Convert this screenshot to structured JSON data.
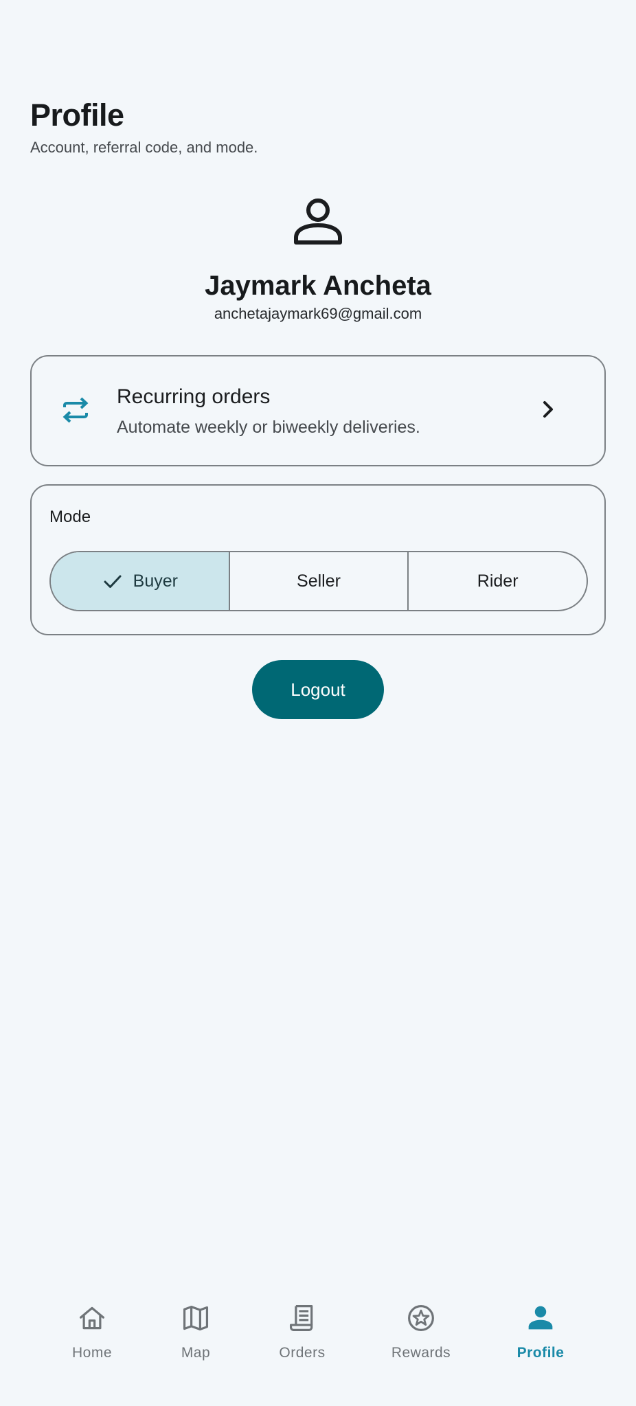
{
  "header": {
    "title": "Profile",
    "subtitle": "Account, referral code, and mode."
  },
  "user": {
    "avatar_icon": "person-icon",
    "name": "Jaymark Ancheta",
    "email": "anchetajaymark69@gmail.com"
  },
  "recurring": {
    "icon": "repeat-icon",
    "title": "Recurring orders",
    "description": "Automate weekly or biweekly deliveries."
  },
  "mode": {
    "label": "Mode",
    "options": [
      {
        "label": "Buyer",
        "selected": true
      },
      {
        "label": "Seller",
        "selected": false
      },
      {
        "label": "Rider",
        "selected": false
      }
    ]
  },
  "logout_label": "Logout",
  "nav": {
    "items": [
      {
        "label": "Home",
        "icon": "home-icon",
        "active": false
      },
      {
        "label": "Map",
        "icon": "map-icon",
        "active": false
      },
      {
        "label": "Orders",
        "icon": "receipt-icon",
        "active": false
      },
      {
        "label": "Rewards",
        "icon": "star-badge-icon",
        "active": false
      },
      {
        "label": "Profile",
        "icon": "person-icon",
        "active": true
      }
    ]
  },
  "colors": {
    "background": "#f3f7fa",
    "accent": "#006874",
    "active_nav": "#1a8aa8",
    "selected_segment": "#cce6ec"
  }
}
